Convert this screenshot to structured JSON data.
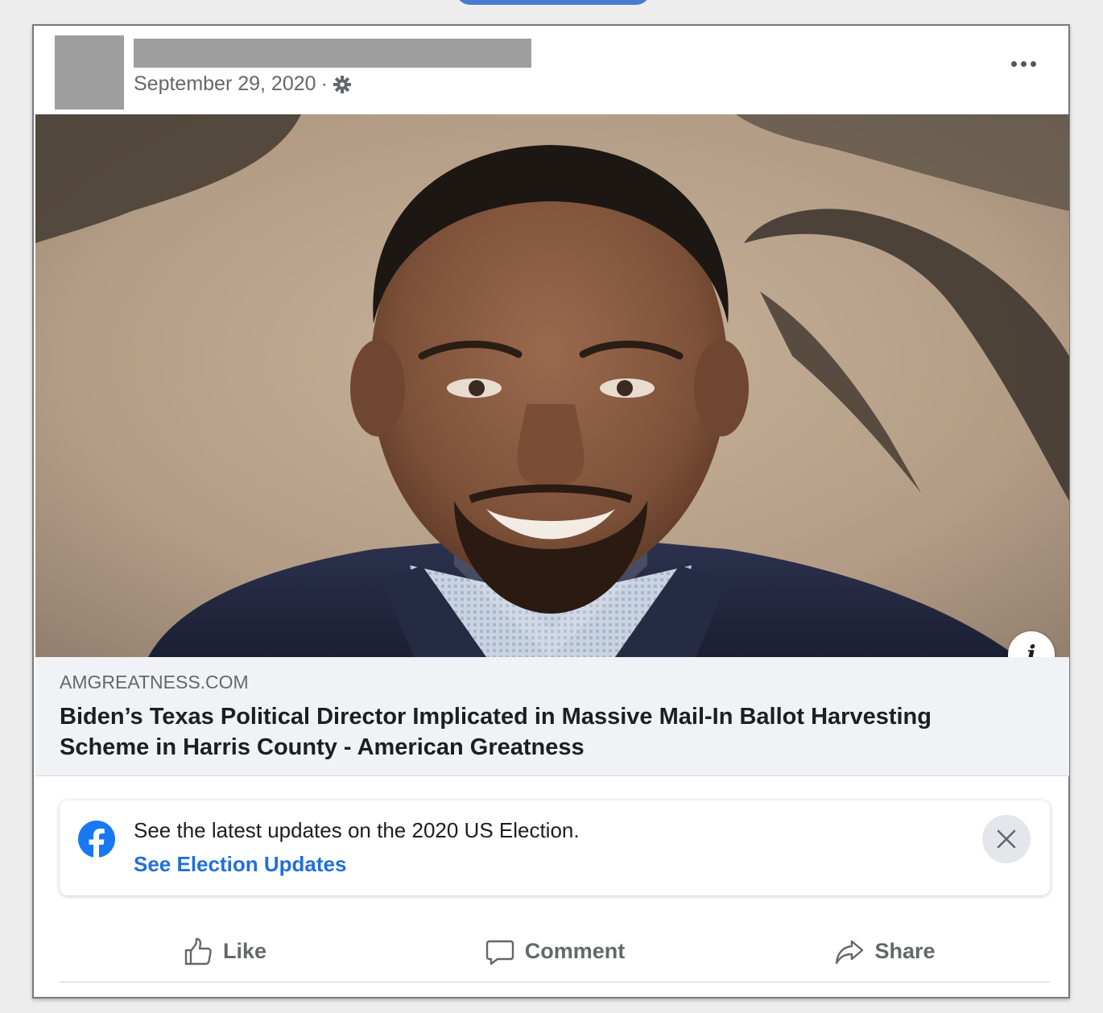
{
  "post": {
    "date": "September 29, 2020",
    "separator": "·",
    "audience_icon": "gear-icon",
    "more_icon": "more-dots-icon"
  },
  "link_preview": {
    "domain": "AMGREATNESS.COM",
    "title": "Biden’s Texas Political Director Implicated in Massive Mail-In Ballot Harvesting Scheme in Harris County - American Greatness",
    "info_icon": "info-icon",
    "info_glyph": "i"
  },
  "election_notice": {
    "icon": "facebook-icon",
    "text": "See the latest updates on the 2020 US Election.",
    "link_label": "See Election Updates",
    "close_icon": "close-icon"
  },
  "actions": {
    "like_label": "Like",
    "comment_label": "Comment",
    "share_label": "Share"
  },
  "colors": {
    "link_blue": "#216fdb",
    "facebook_blue": "#1877f2",
    "muted_text": "#65676b",
    "preview_bg": "#f0f2f5"
  }
}
